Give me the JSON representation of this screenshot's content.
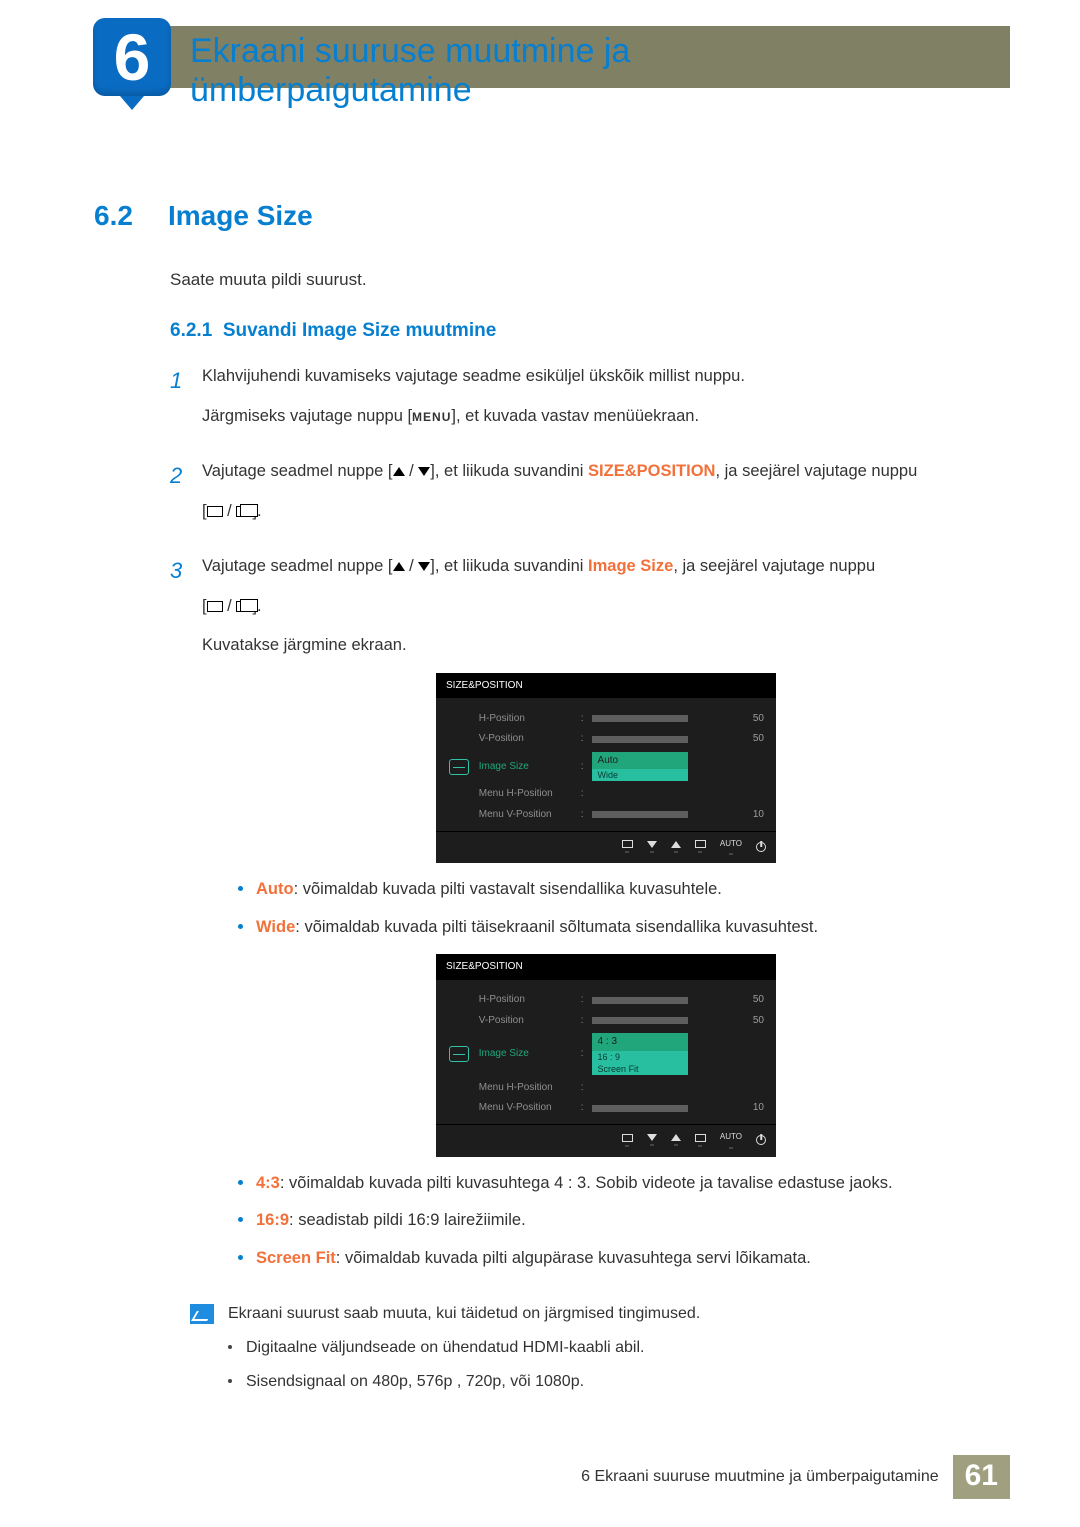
{
  "chapter": {
    "number": "6",
    "title_line1": "Ekraani suuruse muutmine ja",
    "title_line2": "ümberpaigutamine"
  },
  "section": {
    "number": "6.2",
    "title": "Image Size"
  },
  "intro": "Saate muuta pildi suurust.",
  "subsection": {
    "number": "6.2.1",
    "title": "Suvandi Image Size muutmine"
  },
  "steps": {
    "s1": {
      "num": "1",
      "p1": "Klahvijuhendi kuvamiseks vajutage seadme esiküljel ükskõik millist nuppu.",
      "p2a": "Järgmiseks vajutage nuppu [",
      "menu": "MENU",
      "p2b": "], et kuvada vastav menüüekraan."
    },
    "s2": {
      "num": "2",
      "p1a": "Vajutage seadmel nuppe [",
      "p1b": "], et liikuda suvandini ",
      "target": "SIZE&POSITION",
      "p1c": ", ja seejärel vajutage nuppu",
      "p2": "[",
      "p2b": "]."
    },
    "s3": {
      "num": "3",
      "p1a": "Vajutage seadmel nuppe [",
      "p1b": "], et liikuda suvandini ",
      "target": "Image Size",
      "p1c": ", ja seejärel vajutage nuppu",
      "p2": "[",
      "p2b": "].",
      "p3": "Kuvatakse järgmine ekraan."
    }
  },
  "osd": {
    "title": "SIZE&POSITION",
    "rows": {
      "hpos": "H-Position",
      "vpos": "V-Position",
      "imgsize": "Image Size",
      "mhpos": "Menu H-Position",
      "mvpos": "Menu V-Position"
    },
    "vals": {
      "hpos": "50",
      "vpos": "50",
      "mvpos": "10"
    },
    "drop1": {
      "auto": "Auto",
      "wide": "Wide"
    },
    "drop2": {
      "a": "4 : 3",
      "b": "16 : 9",
      "c": "Screen Fit"
    },
    "footer_auto": "AUTO"
  },
  "opts1": {
    "auto_lbl": "Auto",
    "auto_txt": ": võimaldab kuvada pilti vastavalt sisendallika kuvasuhtele.",
    "wide_lbl": "Wide",
    "wide_txt": ": võimaldab kuvada pilti täisekraanil sõltumata sisendallika kuvasuhtest."
  },
  "opts2": {
    "a_lbl": "4:3",
    "a_txt": ": võimaldab kuvada pilti kuvasuhtega 4 : 3. Sobib videote ja tavalise edastuse jaoks.",
    "b_lbl": "16:9",
    "b_txt": ": seadistab pildi 16:9 lairežiimile.",
    "c_lbl": "Screen Fit",
    "c_txt": ": võimaldab kuvada pilti algupärase kuvasuhtega servi lõikamata."
  },
  "note": {
    "lead": "Ekraani suurust saab muuta, kui täidetud on järgmised tingimused.",
    "i1": "Digitaalne väljundseade on ühendatud HDMI-kaabli abil.",
    "i2": "Sisendsignaal on 480p, 576p , 720p, või 1080p."
  },
  "footer": {
    "text": "6 Ekraani suuruse muutmine ja ümberpaigutamine",
    "page": "61"
  }
}
